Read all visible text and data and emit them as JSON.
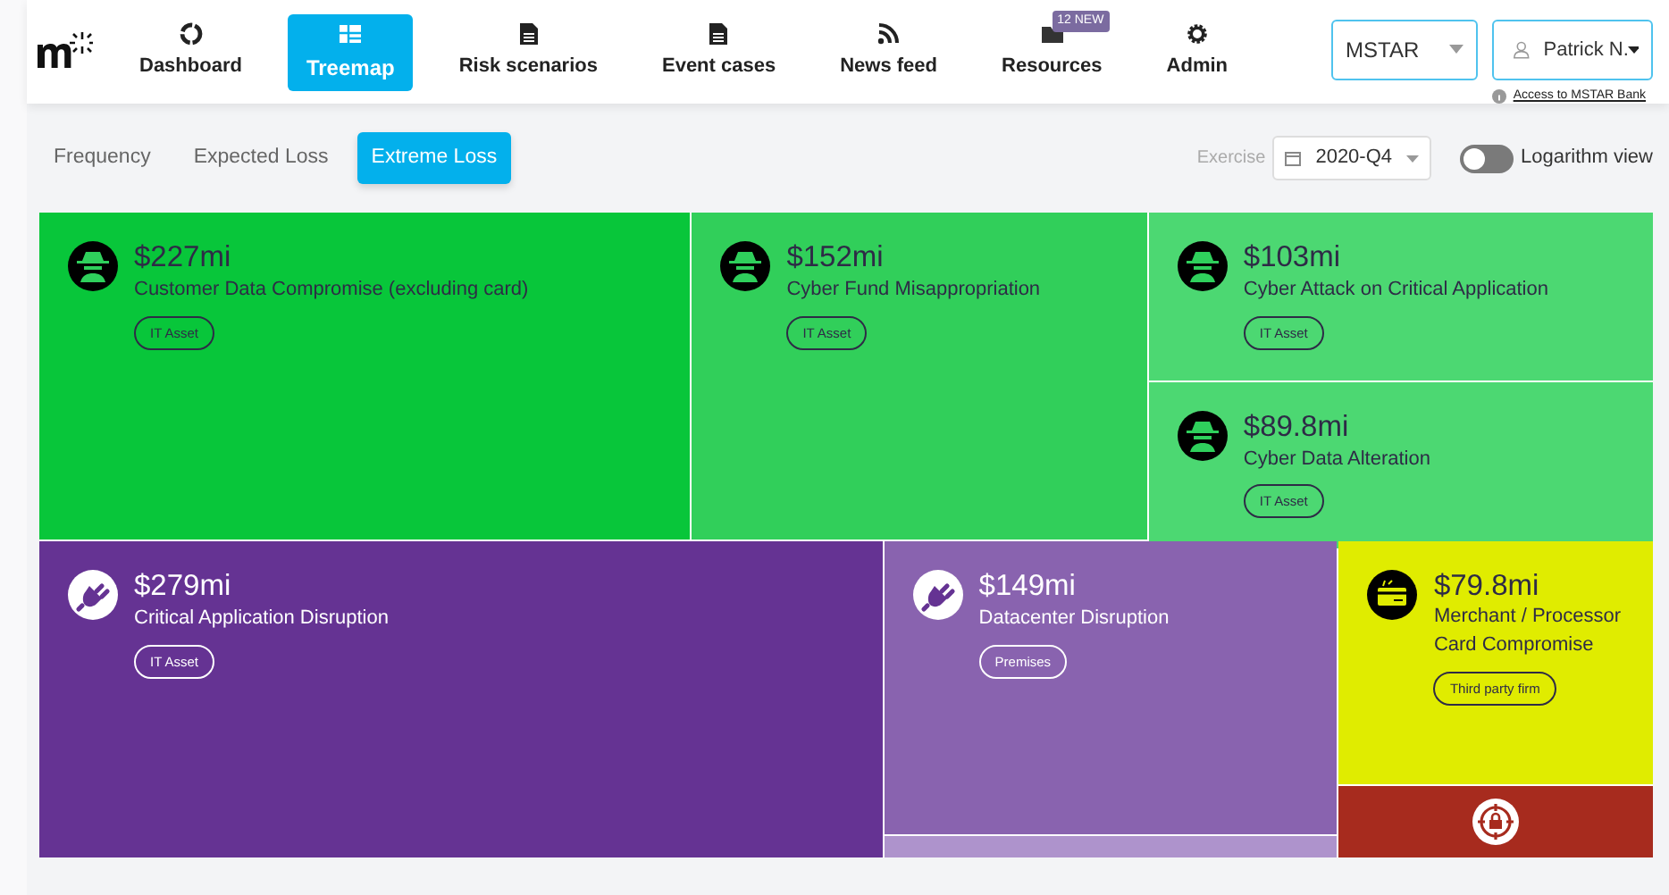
{
  "nav": [
    {
      "label": "Dashboard",
      "selected": false
    },
    {
      "label": "Treemap",
      "selected": true
    },
    {
      "label": "Risk scenarios",
      "selected": false
    },
    {
      "label": "Event cases",
      "selected": false
    },
    {
      "label": "News feed",
      "selected": false
    },
    {
      "label": "Resources",
      "selected": false,
      "badge": "12 NEW"
    },
    {
      "label": "Admin",
      "selected": false
    }
  ],
  "org_select": {
    "value": "MSTAR"
  },
  "user_menu": {
    "name": "Patrick N."
  },
  "access_link": "Access to MSTAR Bank",
  "metric_tabs": [
    {
      "label": "Frequency",
      "selected": false
    },
    {
      "label": "Expected Loss",
      "selected": false
    },
    {
      "label": "Extreme Loss",
      "selected": true
    }
  ],
  "exercise": {
    "label": "Exercise",
    "value": "2020-Q4"
  },
  "log_toggle": {
    "label": "Logarithm view",
    "on": false
  },
  "treemap": [
    {
      "kind": "cyber",
      "color": "#08c63a",
      "amount": "$227mi",
      "name": "Customer Data Compromise (excluding card)",
      "tag": "IT Asset"
    },
    {
      "kind": "cyber",
      "color": "#31cf5a",
      "amount": "$152mi",
      "name": "Cyber Fund Misappropriation",
      "tag": "IT Asset"
    },
    {
      "kind": "cyber",
      "color": "#4cd872",
      "amount": "$103mi",
      "name": "Cyber Attack on Critical Application",
      "tag": "IT Asset"
    },
    {
      "kind": "cyber",
      "color": "#4cd872",
      "amount": "$89.8mi",
      "name": "Cyber Data Alteration",
      "tag": "IT Asset"
    },
    {
      "kind": "disruption",
      "color": "#653393",
      "amount": "$279mi",
      "name": "Critical Application Disruption",
      "tag": "IT Asset"
    },
    {
      "kind": "disruption",
      "color": "#8963af",
      "amount": "$149mi",
      "name": "Datacenter Disruption",
      "tag": "Premises"
    },
    {
      "kind": "blank",
      "color": "#ae93cc"
    },
    {
      "kind": "card",
      "color": "#e0ec00",
      "amount": "$79.8mi",
      "name": "Merchant / Processor Card Compromise",
      "tag": "Third party firm"
    },
    {
      "kind": "lock",
      "color": "#a72b1e"
    }
  ]
}
